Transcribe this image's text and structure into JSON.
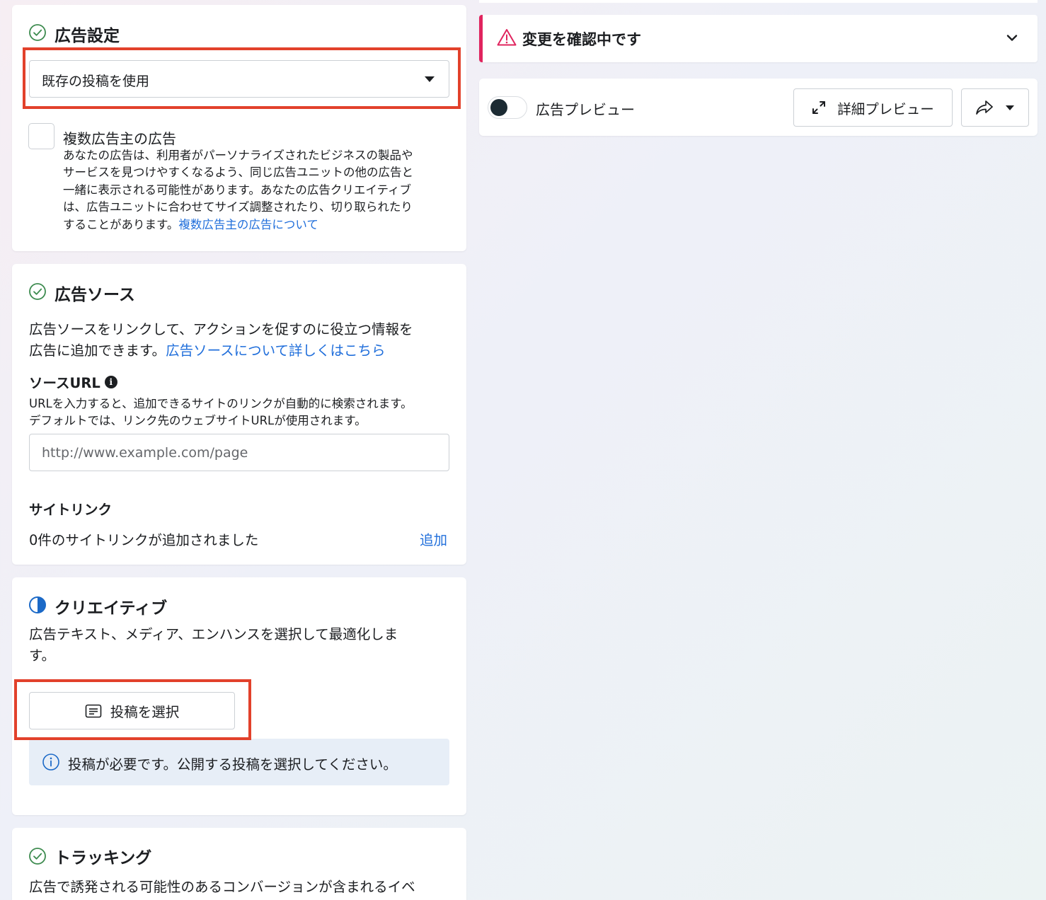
{
  "ad_settings": {
    "title": "広告設定",
    "dropdown_value": "既存の投稿を使用",
    "multi_advertiser": {
      "label": "複数広告主の広告",
      "description_lines": [
        "あなたの広告は、利用者がパーソナライズされたビジネスの製品や",
        "サービスを見つけやすくなるよう、同じ広告ユニットの他の広告と",
        "一緒に表示される可能性があります。あなたの広告クリエイティブ",
        "は、広告ユニットに合わせてサイズ調整されたり、切り取られたり"
      ],
      "description_last": "することがあります。",
      "link": "複数広告主の広告について"
    }
  },
  "ad_source": {
    "title": "広告ソース",
    "description_line1": "広告ソースをリンクして、アクションを促すのに役立つ情報を",
    "description_line2": "広告に追加できます。",
    "link": "広告ソースについて詳しくはこちら",
    "source_url_label": "ソースURL",
    "source_url_help_line1": "URLを入力すると、追加できるサイトのリンクが自動的に検索されます。",
    "source_url_help_line2": "デフォルトでは、リンク先のウェブサイトURLが使用されます。",
    "source_url_placeholder": "http://www.example.com/page",
    "sitelinks_label": "サイトリンク",
    "sitelinks_status": "0件のサイトリンクが追加されました",
    "add_label": "追加"
  },
  "creative": {
    "title": "クリエイティブ",
    "description_line1": "広告テキスト、メディア、エンハンスを選択して最適化しま",
    "description_line2": "す。",
    "select_post_label": "投稿を選択",
    "info_message": "投稿が必要です。公開する投稿を選択してください。"
  },
  "tracking": {
    "title": "トラッキング",
    "description_partial": "広告で誘発される可能性のあるコンバージョンが含まれるイベ"
  },
  "review": {
    "title": "変更を確認中です"
  },
  "preview": {
    "toggle_label": "広告プレビュー",
    "detail_preview_label": "詳細プレビュー"
  },
  "colors": {
    "link": "#216fdb",
    "success": "#31a24c",
    "warning": "#e0245e",
    "highlight": "#e2412b",
    "info_bg": "#e7eef7"
  }
}
